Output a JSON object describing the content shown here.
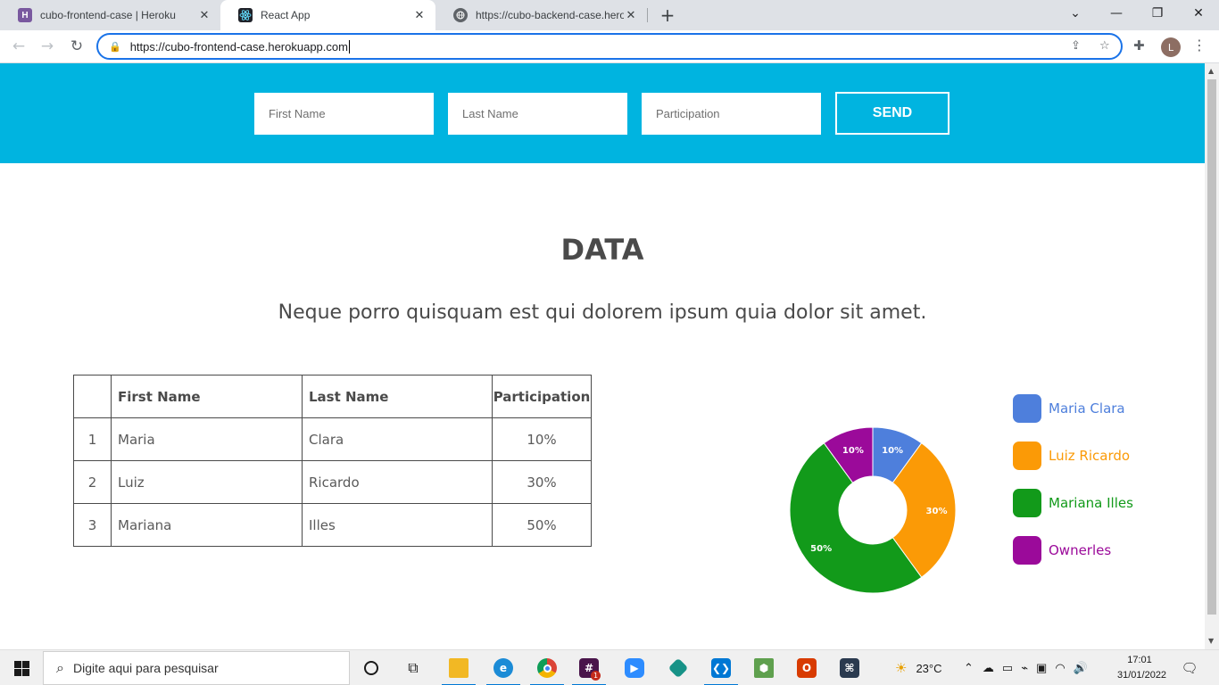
{
  "browser": {
    "tabs": [
      {
        "title": "cubo-frontend-case | Heroku",
        "icon": "heroku-icon",
        "active": false
      },
      {
        "title": "React App",
        "icon": "react-icon",
        "active": true
      },
      {
        "title": "https://cubo-backend-case.herok",
        "icon": "globe-icon",
        "active": false
      }
    ],
    "url": "https://cubo-frontend-case.herokuapp.com",
    "profile_initial": "L"
  },
  "form": {
    "first_name_placeholder": "First Name",
    "last_name_placeholder": "Last Name",
    "participation_placeholder": "Participation",
    "send_label": "SEND",
    "accent_color": "#00b4e0"
  },
  "content": {
    "title": "DATA",
    "subtitle": "Neque porro quisquam est qui dolorem ipsum quia dolor sit amet."
  },
  "table": {
    "headers": [
      "",
      "First Name",
      "Last Name",
      "Participation"
    ],
    "rows": [
      {
        "index": "1",
        "first": "Maria",
        "last": "Clara",
        "participation": "10%"
      },
      {
        "index": "2",
        "first": "Luiz",
        "last": "Ricardo",
        "participation": "30%"
      },
      {
        "index": "3",
        "first": "Mariana",
        "last": "Illes",
        "participation": "50%"
      }
    ]
  },
  "chart_data": {
    "type": "pie",
    "donut": true,
    "categories": [
      "Maria Clara",
      "Luiz Ricardo",
      "Mariana Illes",
      "Ownerles"
    ],
    "values": [
      10,
      30,
      50,
      10
    ],
    "value_labels": [
      "10%",
      "30%",
      "50%",
      "10%"
    ],
    "colors": [
      "#4e7fdc",
      "#fb9a06",
      "#129a1a",
      "#9b0a9a"
    ],
    "legend_position": "right"
  },
  "taskbar": {
    "search_placeholder": "Digite aqui para pesquisar",
    "weather": "23°C",
    "time": "17:01",
    "date": "31/01/2022",
    "slack_badge": "1"
  }
}
